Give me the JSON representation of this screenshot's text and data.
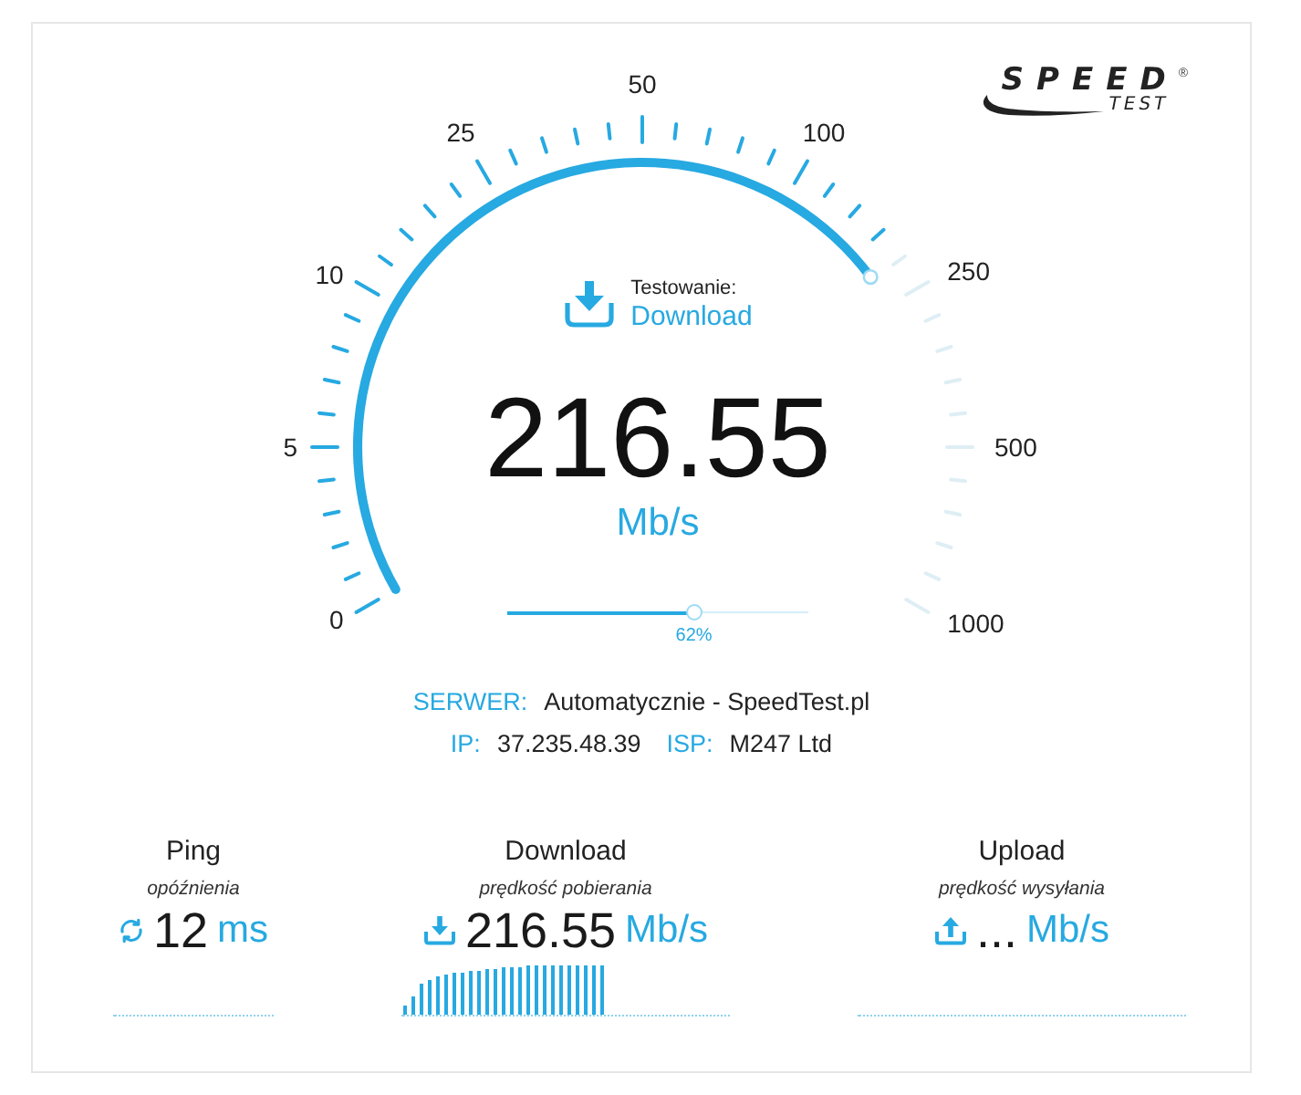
{
  "logo": {
    "wordmark": "SPEED",
    "subtitle": "TEST",
    "registered": "®"
  },
  "gauge": {
    "scale_labels": [
      "0",
      "5",
      "10",
      "25",
      "50",
      "100",
      "250",
      "500",
      "1000"
    ],
    "status": "Testowanie:",
    "phase": "Download",
    "value": "216.55",
    "unit": "Mb/s"
  },
  "progress": {
    "level": 0.62,
    "label": "62%"
  },
  "server": {
    "label": "SERWER:",
    "value": "Automatycznie - SpeedTest.pl"
  },
  "connection": [
    {
      "label": "IP:",
      "value": "37.235.48.39"
    },
    {
      "label": "ISP:",
      "value": "M247 Ltd"
    }
  ],
  "results": [
    {
      "kind": "ping",
      "title": "Ping",
      "subtitle": "opóźnienia",
      "value": "12",
      "unit": "ms"
    },
    {
      "kind": "download",
      "title": "Download",
      "subtitle": "prędkość pobierania",
      "value": "216.55",
      "unit": "Mb/s"
    },
    {
      "kind": "upload",
      "title": "Upload",
      "subtitle": "prędkość wysyłania",
      "value": "...",
      "unit": "Mb/s"
    }
  ]
}
